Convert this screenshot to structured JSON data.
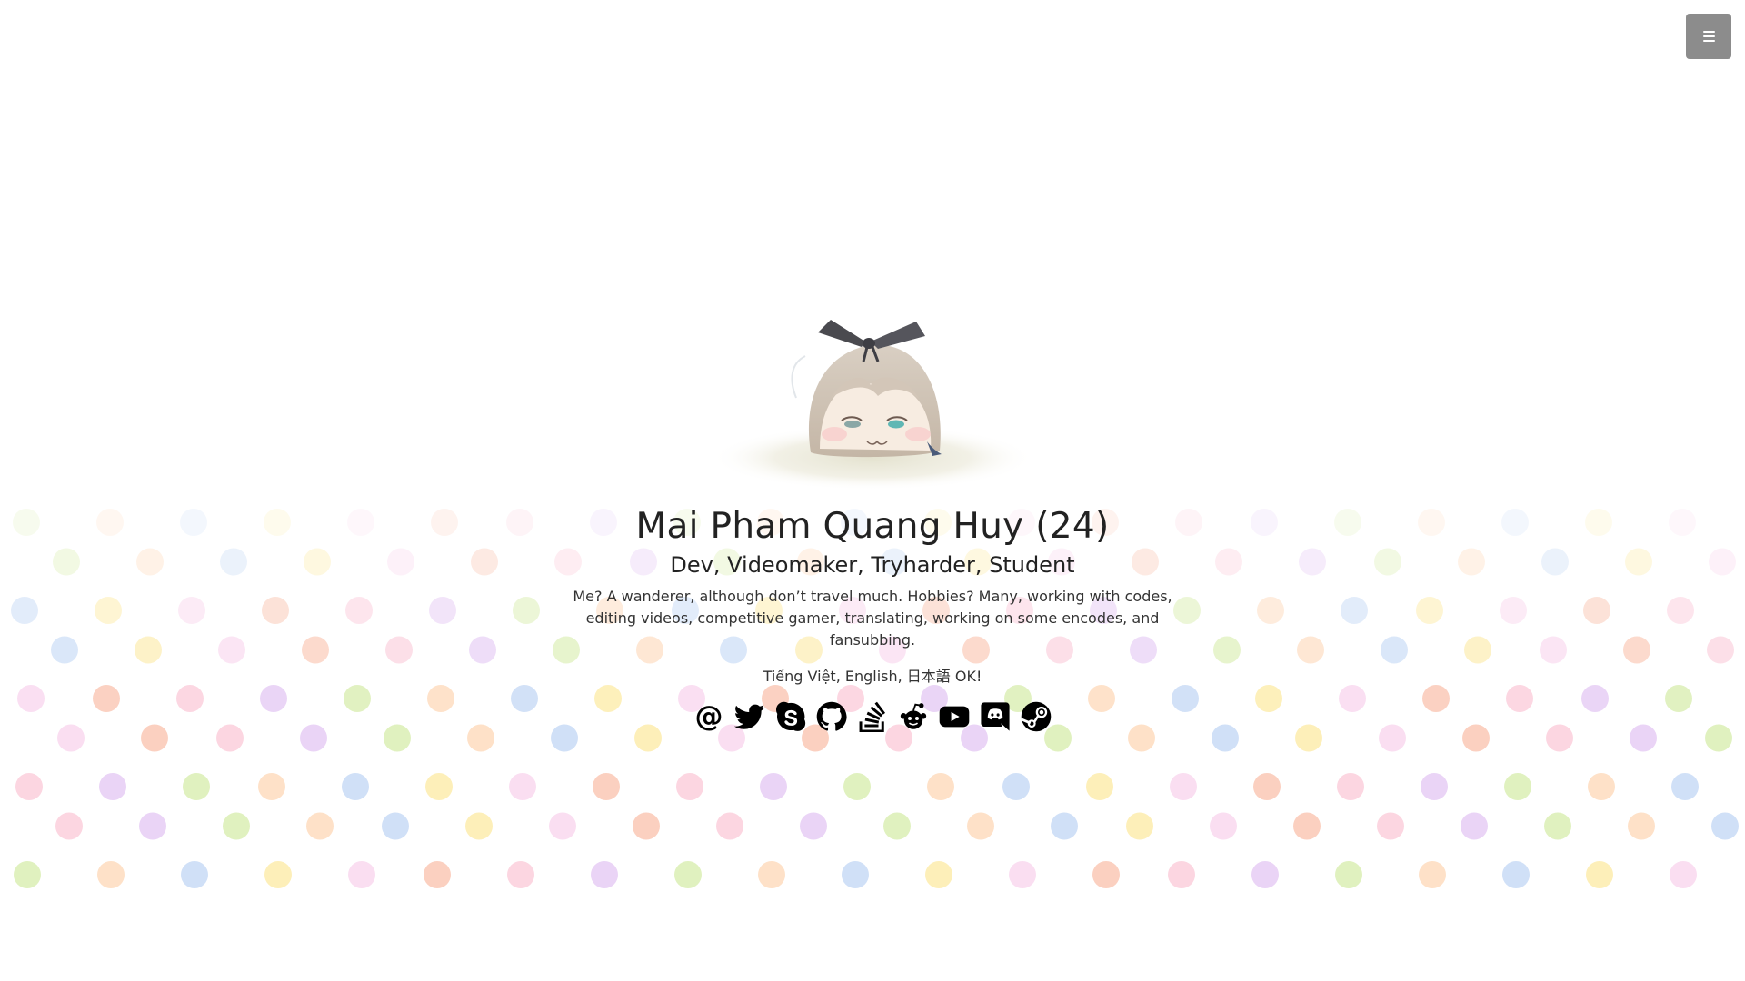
{
  "profile": {
    "name": "Mai Pham Quang Huy (24)",
    "roles": "Dev, Videomaker, Tryharder, Student",
    "bio": "Me? A wanderer, although don’t travel much. Hobbies? Many, working with codes, editing videos, competitive gamer, translating, working on some encodes, and fansubbing.",
    "languages": "Tiếng Việt, English, 日本語 OK!"
  },
  "menu": {
    "icon": "hamburger-menu-icon",
    "color": "#8c8c8c"
  },
  "avatar": {
    "icon": "chibi-girl-avatar"
  },
  "socials": [
    {
      "icon": "email-icon",
      "glyph": "@"
    },
    {
      "icon": "twitter-icon"
    },
    {
      "icon": "skype-icon"
    },
    {
      "icon": "github-icon"
    },
    {
      "icon": "stack-overflow-icon"
    },
    {
      "icon": "reddit-icon"
    },
    {
      "icon": "youtube-icon"
    },
    {
      "icon": "discord-icon"
    },
    {
      "icon": "steam-icon"
    }
  ],
  "background": {
    "pattern": "watercolor-polka-dots",
    "colors": [
      "#f9b4c9",
      "#fbe27f",
      "#c7e58a",
      "#f7a98c",
      "#aac7f0",
      "#d8b0ee",
      "#f6c3e6",
      "#fdc89b"
    ]
  }
}
